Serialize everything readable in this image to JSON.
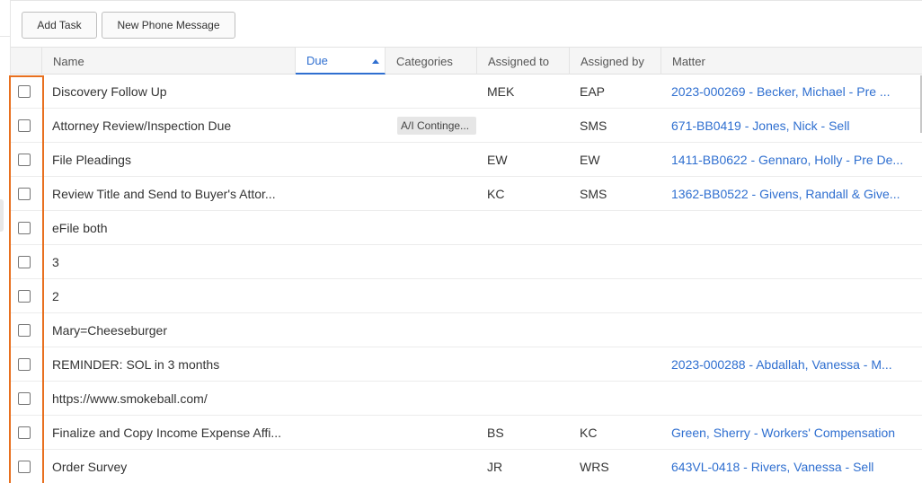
{
  "toolbar": {
    "add_task_label": "Add Task",
    "new_phone_message_label": "New Phone Message"
  },
  "columns": {
    "name": "Name",
    "due": "Due",
    "categories": "Categories",
    "assigned_to": "Assigned to",
    "assigned_by": "Assigned by",
    "matter": "Matter"
  },
  "sort": {
    "column": "due",
    "direction": "ascending"
  },
  "colors": {
    "link": "#2f6fd0",
    "highlight": "#e8701f"
  },
  "rows": [
    {
      "name": "Discovery Follow Up",
      "category": "",
      "assigned_to": "MEK",
      "assigned_by": "EAP",
      "matter": "2023-000269 - Becker, Michael - Pre ..."
    },
    {
      "name": "Attorney Review/Inspection Due",
      "category": "A/I Continge...",
      "assigned_to": "",
      "assigned_by": "SMS",
      "matter": "671-BB0419 - Jones, Nick - Sell"
    },
    {
      "name": "File Pleadings",
      "category": "",
      "assigned_to": "EW",
      "assigned_by": "EW",
      "matter": "1411-BB0622 - Gennaro, Holly - Pre De..."
    },
    {
      "name": "Review Title and Send to Buyer's Attor...",
      "category": "",
      "assigned_to": "KC",
      "assigned_by": "SMS",
      "matter": "1362-BB0522 - Givens, Randall & Give..."
    },
    {
      "name": "eFile both",
      "category": "",
      "assigned_to": "",
      "assigned_by": "",
      "matter": ""
    },
    {
      "name": "3",
      "category": "",
      "assigned_to": "",
      "assigned_by": "",
      "matter": ""
    },
    {
      "name": "2",
      "category": "",
      "assigned_to": "",
      "assigned_by": "",
      "matter": ""
    },
    {
      "name": "Mary=Cheeseburger",
      "category": "",
      "assigned_to": "",
      "assigned_by": "",
      "matter": ""
    },
    {
      "name": "REMINDER: SOL in 3 months",
      "category": "",
      "assigned_to": "",
      "assigned_by": "",
      "matter": "2023-000288 - Abdallah, Vanessa - M..."
    },
    {
      "name": "https://www.smokeball.com/",
      "category": "",
      "assigned_to": "",
      "assigned_by": "",
      "matter": ""
    },
    {
      "name": "Finalize and Copy Income Expense Affi...",
      "category": "",
      "assigned_to": "BS",
      "assigned_by": "KC",
      "matter": "Green, Sherry - Workers' Compensation"
    },
    {
      "name": "Order Survey",
      "category": "",
      "assigned_to": "JR",
      "assigned_by": "WRS",
      "matter": "643VL-0418 - Rivers, Vanessa - Sell"
    }
  ]
}
